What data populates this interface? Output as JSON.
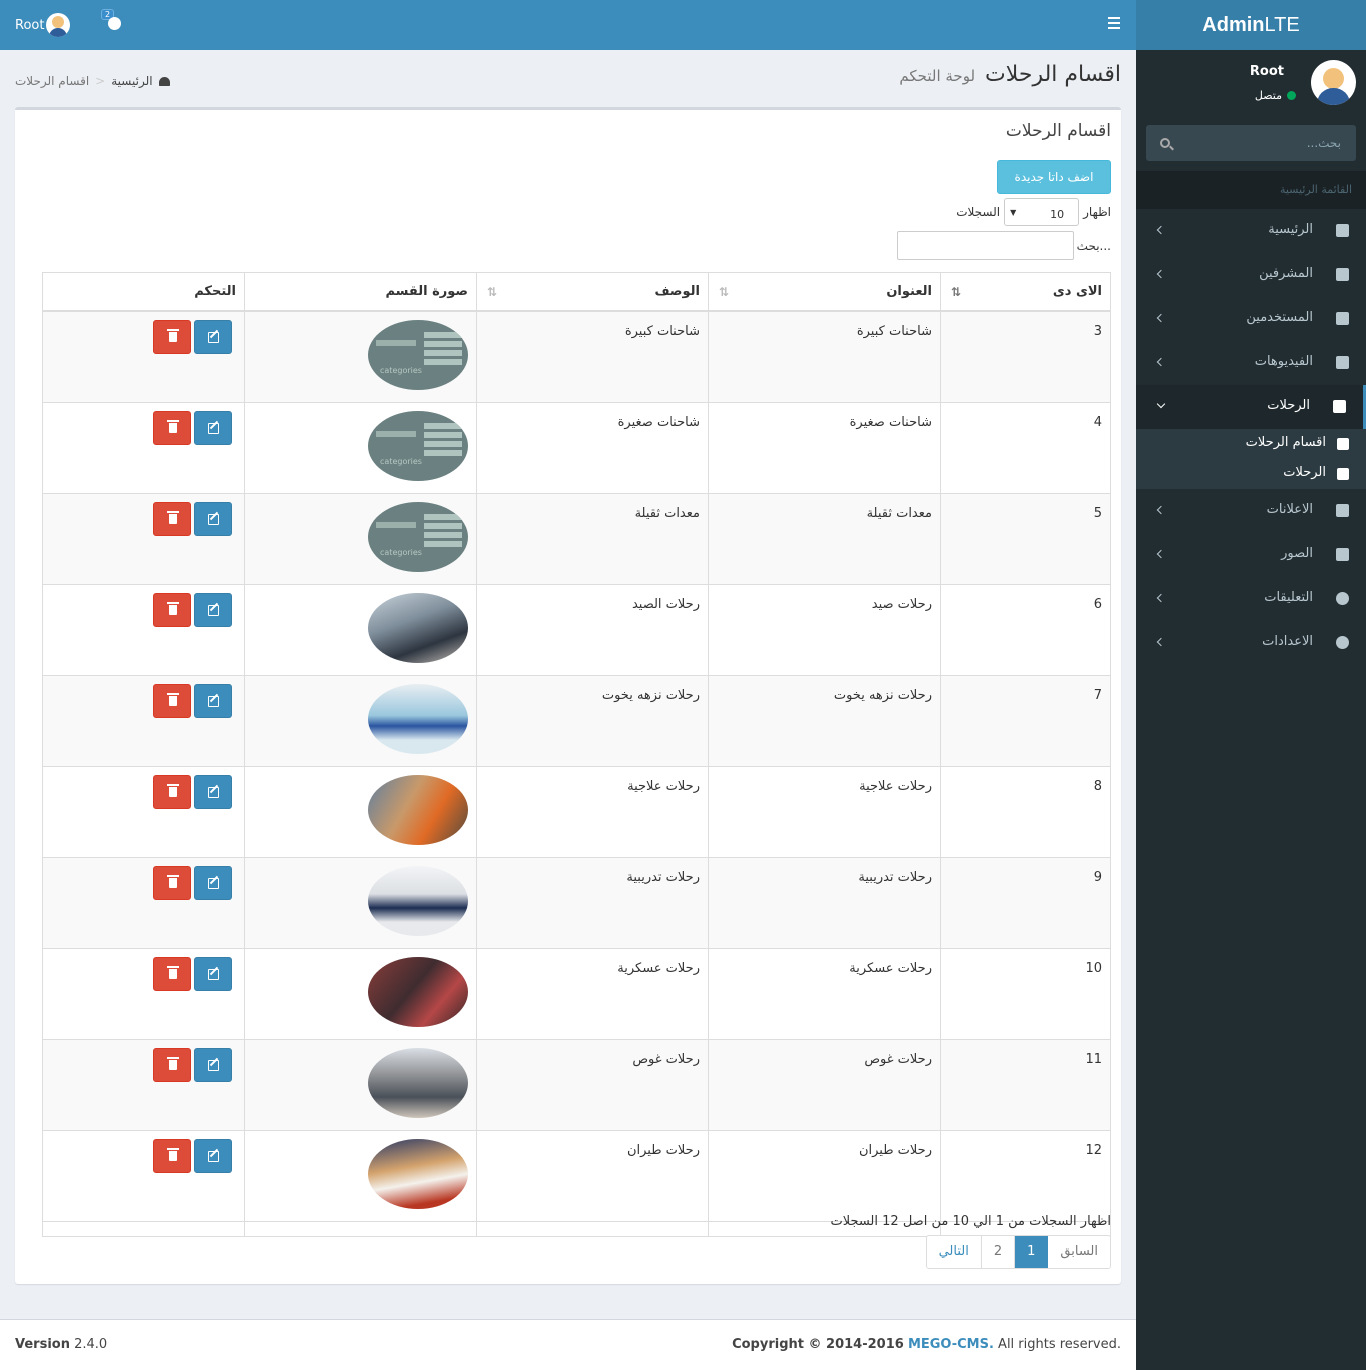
{
  "header": {
    "user_name": "Root",
    "notifications_count": "2"
  },
  "logo": {
    "bold": "Admin",
    "rest": "LTE"
  },
  "sidebar": {
    "user_name": "Root",
    "status": "متصل",
    "search_placeholder": "بحث...",
    "section_header": "القائمة الرئيسية",
    "items": [
      {
        "label": "الرئيسية",
        "icon": "dashboard-icon"
      },
      {
        "label": "المشرفين",
        "icon": "user-secret-icon"
      },
      {
        "label": "المستخدمين",
        "icon": "user-icon"
      },
      {
        "label": "الفيديوهات",
        "icon": "user-icon"
      },
      {
        "label": "الرحلات",
        "icon": "plane-icon"
      },
      {
        "label": "الاعلانات",
        "icon": "paypal-icon"
      },
      {
        "label": "الصور",
        "icon": "image-icon"
      },
      {
        "label": "التعليقات",
        "icon": "comment-icon"
      },
      {
        "label": "الاعدادات",
        "icon": "gear-icon"
      }
    ],
    "submenu": [
      {
        "label": "اقسام الرحلات",
        "icon": "flag-icon"
      },
      {
        "label": "الرحلات",
        "icon": "plane-icon"
      }
    ]
  },
  "content": {
    "title": "اقسام الرحلات",
    "subtitle": "لوحة التحكم",
    "breadcrumb_home": "الرئيسية",
    "breadcrumb_current": "اقسام الرحلات"
  },
  "box": {
    "title": "اقسام الرحلات",
    "add_button": "اضف داتا جديدة",
    "length_prefix": "اظهار",
    "length_value": "10",
    "length_suffix": "السجلات",
    "search_label": "بحث...",
    "columns": [
      "الاى دى",
      "العنوان",
      "الوصف",
      "صورة القسم",
      "التحكم"
    ],
    "rows": [
      {
        "id": "3",
        "title": "شاحنات كبيرة",
        "desc": "شاحنات كبيرة",
        "img": "cat"
      },
      {
        "id": "4",
        "title": "شاحنات صغيرة",
        "desc": "شاحنات صغيرة",
        "img": "cat"
      },
      {
        "id": "5",
        "title": "معدات ثقيلة",
        "desc": "معدات ثقيلة",
        "img": "cat"
      },
      {
        "id": "6",
        "title": "رحلات صيد",
        "desc": "رحلات الصيد",
        "img": "photo1"
      },
      {
        "id": "7",
        "title": "رحلات نزهه يخوت",
        "desc": "رحلات نزهه يخوت",
        "img": "photo2"
      },
      {
        "id": "8",
        "title": "رحلات علاجية",
        "desc": "رحلات علاجية",
        "img": "photo3"
      },
      {
        "id": "9",
        "title": "رحلات تدريبية",
        "desc": "رحلات تدريبية",
        "img": "photo4"
      },
      {
        "id": "10",
        "title": "رحلات عسكرية",
        "desc": "رحلات عسكرية",
        "img": "photo5"
      },
      {
        "id": "11",
        "title": "رحلات غوص",
        "desc": "رحلات غوص",
        "img": "photo6"
      },
      {
        "id": "12",
        "title": "رحلات طيران",
        "desc": "رحلات طيران",
        "img": "photo7"
      }
    ],
    "info": "اظهار السجلات من 1 الي 10 من اصل 12 السجلات",
    "pager": {
      "prev": "السابق",
      "pages": [
        "1",
        "2"
      ],
      "next": "التالي"
    }
  },
  "footer": {
    "version_label": "Version",
    "version": "2.4.0",
    "copy_prefix": "Copyright © 2014-2016",
    "brand": "MEGO-CMS.",
    "copy_suffix": "All rights reserved."
  },
  "colors": {
    "primary": "#3c8dbc",
    "danger": "#dd4b39",
    "info": "#5bc0de",
    "sidebar": "#222d32"
  }
}
